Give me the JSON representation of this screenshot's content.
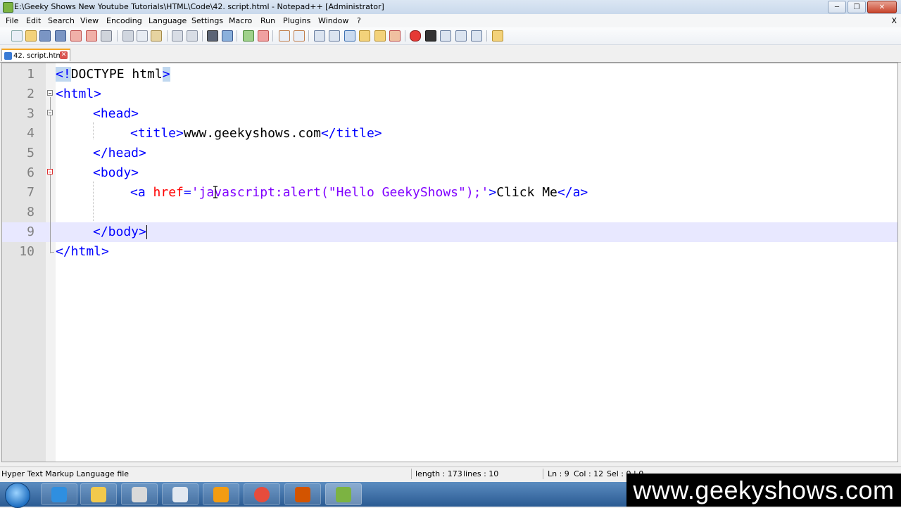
{
  "window": {
    "title": "E:\\Geeky Shows New Youtube Tutorials\\HTML\\Code\\42. script.html - Notepad++ [Administrator]",
    "minimize_label": "─",
    "restore_label": "❐",
    "close_label": "✕"
  },
  "menubar": {
    "items": [
      "File",
      "Edit",
      "Search",
      "View",
      "Encoding",
      "Language",
      "Settings",
      "Macro",
      "Run",
      "Plugins",
      "Window",
      "?"
    ],
    "close_doc": "X"
  },
  "toolbar": {
    "icons": [
      "new-file-icon",
      "open-file-icon",
      "save-icon",
      "save-all-icon",
      "close-icon",
      "close-all-icon",
      "print-icon",
      "cut-icon",
      "copy-icon",
      "paste-icon",
      "undo-icon",
      "redo-icon",
      "find-icon",
      "replace-icon",
      "zoom-in-icon",
      "zoom-out-icon",
      "sync-vertical-icon",
      "sync-horizontal-icon",
      "word-wrap-icon",
      "show-all-chars-icon",
      "indent-guide-icon",
      "user-language-icon",
      "doc-map-icon",
      "function-list-icon",
      "record-macro-icon",
      "stop-macro-icon",
      "play-macro-icon",
      "run-macro-multiple-icon",
      "save-macro-icon",
      "launch-browser-icon"
    ]
  },
  "tabs": [
    {
      "label": "42. script.html",
      "close": "✕"
    }
  ],
  "editor": {
    "lines": [
      {
        "num": "1"
      },
      {
        "num": "2"
      },
      {
        "num": "3"
      },
      {
        "num": "4"
      },
      {
        "num": "5"
      },
      {
        "num": "6"
      },
      {
        "num": "7"
      },
      {
        "num": "8"
      },
      {
        "num": "9"
      },
      {
        "num": "10"
      }
    ],
    "tokens": {
      "l1_open": "<!",
      "l1_doctype": "DOCTYPE html",
      "l1_close": ">",
      "l2": "<html>",
      "l3": "<head>",
      "l4_open": "<title>",
      "l4_text": "www.geekyshows.com",
      "l4_close": "</title>",
      "l5": "</head>",
      "l6": "<body>",
      "l7_tag": "<a ",
      "l7_attr": "href",
      "l7_eq": "=",
      "l7_val": "'javascript:alert(\"Hello GeekyShows\");'",
      "l7_gt": ">",
      "l7_text": "Click Me",
      "l7_close": "</a>",
      "l9": "</body>",
      "l10": "</html>"
    }
  },
  "statusbar": {
    "filetype": "Hyper Text Markup Language file",
    "length": "length : 173",
    "lines": "lines : 10",
    "ln": "Ln : 9",
    "col": "Col : 12",
    "sel": "Sel : 0 | 0"
  },
  "taskbar": {
    "apps": [
      "internet-explorer-icon",
      "file-explorer-icon",
      "reader-icon",
      "snipping-tool-icon",
      "media-player-icon",
      "chrome-icon",
      "powerpoint-icon",
      "notepad-plus-plus-icon"
    ]
  },
  "watermark": {
    "text": "www.geekyshows.com"
  }
}
